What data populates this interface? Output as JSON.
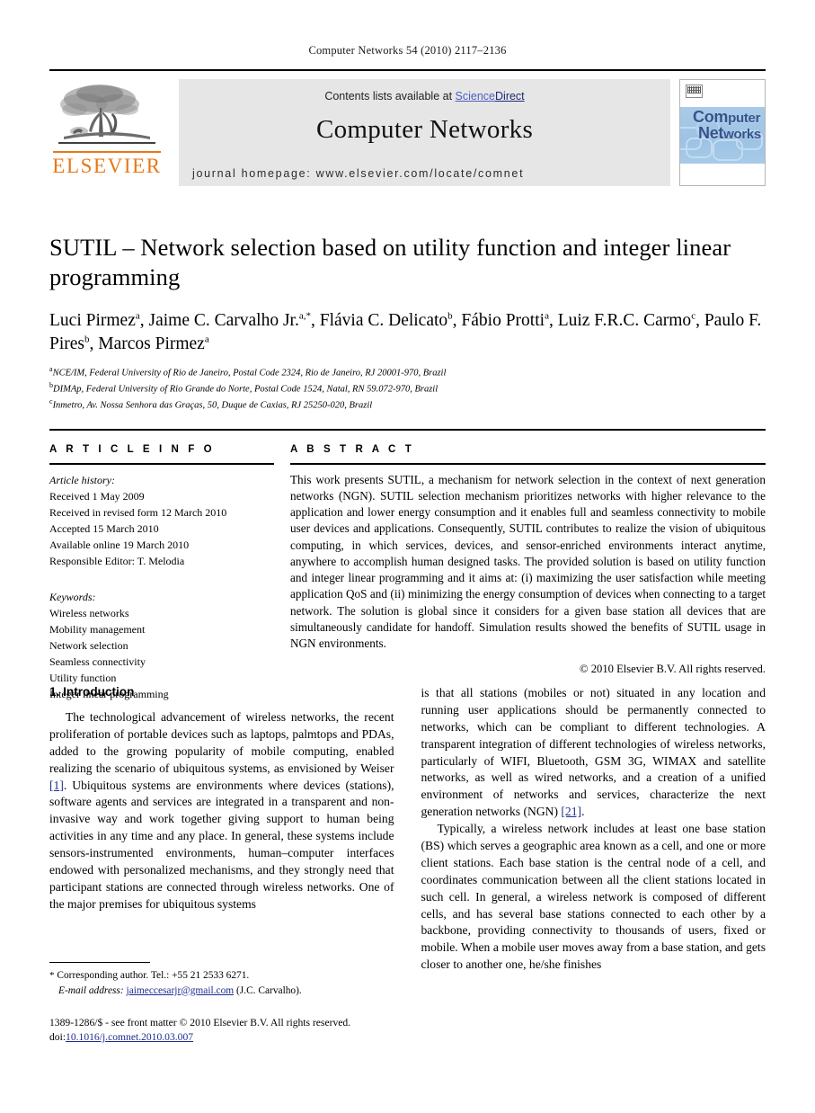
{
  "running_head": "Computer Networks 54 (2010) 2117–2136",
  "masthead": {
    "publisher_name": "ELSEVIER",
    "contents_prefix": "Contents lists available at ",
    "sciencedirect_a": "Science",
    "sciencedirect_b": "Direct",
    "journal_title": "Computer Networks",
    "homepage": "journal homepage: www.elsevier.com/locate/comnet",
    "cover": {
      "line1": "Com",
      "line1b": "puter",
      "line2": "Net",
      "line2b": "works"
    },
    "colors": {
      "elsevier_orange": "#E77817",
      "link_blue": "#1e2d8f",
      "box_gray": "#e6e6e6"
    }
  },
  "article": {
    "title": "SUTIL – Network selection based on utility function and integer linear programming",
    "authors": [
      {
        "name": "Luci Pirmez",
        "sup": "a",
        "sep": ", "
      },
      {
        "name": "Jaime C. Carvalho Jr.",
        "sup": "a,*",
        "sep": ", "
      },
      {
        "name": "Flávia C. Delicato",
        "sup": "b",
        "sep": ", "
      },
      {
        "name": "Fábio Protti",
        "sup": "a",
        "sep": ", "
      },
      {
        "name": "Luiz F.R.C. Carmo",
        "sup": "c",
        "sep": ", "
      },
      {
        "name": "Paulo F. Pires",
        "sup": "b",
        "sep": ", "
      },
      {
        "name": "Marcos Pirmez",
        "sup": "a",
        "sep": ""
      }
    ],
    "affiliations": [
      {
        "mark": "a",
        "text": "NCE/IM, Federal University of Rio de Janeiro, Postal Code 2324, Rio de Janeiro, RJ 20001-970, Brazil"
      },
      {
        "mark": "b",
        "text": "DIMAp, Federal University of Rio Grande do Norte, Postal Code 1524, Natal, RN 59.072-970, Brazil"
      },
      {
        "mark": "c",
        "text": "Inmetro, Av. Nossa Senhora das Graças, 50, Duque de Caxias, RJ 25250-020, Brazil"
      }
    ]
  },
  "article_info": {
    "heading": "A R T I C L E  I N F O",
    "history_label": "Article history:",
    "history": [
      "Received 1 May 2009",
      "Received in revised form 12 March 2010",
      "Accepted 15 March 2010",
      "Available online 19 March 2010",
      "Responsible Editor: T. Melodia"
    ],
    "keywords_label": "Keywords:",
    "keywords": [
      "Wireless networks",
      "Mobility management",
      "Network selection",
      "Seamless connectivity",
      "Utility function",
      "Integer linear programming"
    ]
  },
  "abstract": {
    "heading": "A B S T R A C T",
    "text": "This work presents SUTIL, a mechanism for network selection in the context of next generation networks (NGN). SUTIL selection mechanism prioritizes networks with higher relevance to the application and lower energy consumption and it enables full and seamless connectivity to mobile user devices and applications. Consequently, SUTIL contributes to realize the vision of ubiquitous computing, in which services, devices, and sensor-enriched environments interact anytime, anywhere to accomplish human designed tasks. The provided solution is based on utility function and integer linear programming and it aims at: (i) maximizing the user satisfaction while meeting application QoS and (ii) minimizing the energy consumption of devices when connecting to a target network. The solution is global since it considers for a given base station all devices that are simultaneously candidate for handoff. Simulation results showed the benefits of SUTIL usage in NGN environments.",
    "copyright": "© 2010 Elsevier B.V. All rights reserved."
  },
  "body": {
    "section_title": "1. Introduction",
    "left_para_1_a": "The technological advancement of wireless networks, the recent proliferation of portable devices such as laptops, palmtops and PDAs, added to the growing popularity of mobile computing, enabled realizing the scenario of ubiquitous systems, as envisioned by Weiser ",
    "left_para_1_ref": "[1]",
    "left_para_1_b": ". Ubiquitous systems are environments where devices (stations), software agents and services are integrated in a transparent and non-invasive way and work together giving support to human being activities in any time and any place. In general, these systems include sensors-instrumented environments, human–computer interfaces endowed with personalized mechanisms, and they strongly need that participant stations are connected through wireless networks. One of the major premises for ubiquitous systems",
    "right_para_1_a": "is that all stations (mobiles or not) situated in any location and running user applications should be permanently connected to networks, which can be compliant to different technologies. A transparent integration of different technologies of wireless networks, particularly of WIFI, Bluetooth, GSM 3G, WIMAX and satellite networks, as well as wired networks, and a creation of a unified environment of networks and services, characterize the next generation networks (NGN) ",
    "right_para_1_ref": "[21]",
    "right_para_1_b": ".",
    "right_para_2": "Typically, a wireless network includes at least one base station (BS) which serves a geographic area known as a cell, and one or more client stations. Each base station is the central node of a cell, and coordinates communication between all the client stations located in such cell. In general, a wireless network is composed of different cells, and has several base stations connected to each other by a backbone, providing connectivity to thousands of users, fixed or mobile. When a mobile user moves away from a base station, and gets closer to another one, he/she finishes"
  },
  "footer": {
    "corresponding_star": "*",
    "corresponding_text": "Corresponding author. Tel.: +55 21 2533 6271.",
    "email_label": "E-mail address:",
    "email": "jaimeccesarjr@gmail.com",
    "email_owner": "(J.C. Carvalho).",
    "imprint_a": "1389-1286/$ - see front matter © 2010 Elsevier B.V. All rights reserved.",
    "imprint_doi_label": "doi:",
    "imprint_doi": "10.1016/j.comnet.2010.03.007"
  }
}
